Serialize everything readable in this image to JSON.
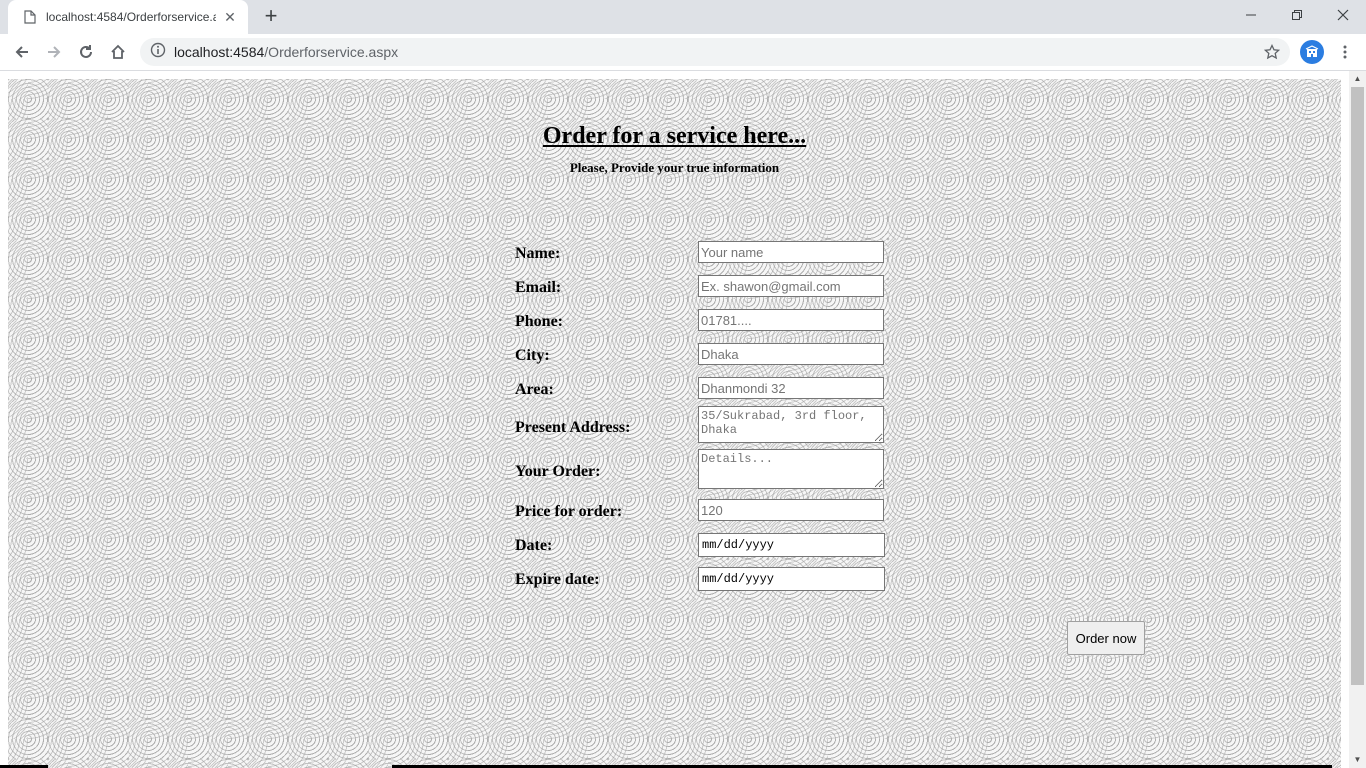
{
  "browser": {
    "tab_title": "localhost:4584/Orderforservice.as",
    "url_host": "localhost:4584",
    "url_path": "/Orderforservice.aspx"
  },
  "page": {
    "title": "Order for a service here...",
    "subtitle": "Please, Provide your true information",
    "form": {
      "name_label": "Name:",
      "name_placeholder": "Your name",
      "email_label": "Email:",
      "email_placeholder": "Ex. shawon@gmail.com",
      "phone_label": "Phone:",
      "phone_placeholder": "01781....",
      "city_label": "City:",
      "city_placeholder": "Dhaka",
      "area_label": "Area:",
      "area_placeholder": "Dhanmondi 32",
      "address_label": "Present Address:",
      "address_placeholder": "35/Sukrabad, 3rd floor, Dhaka",
      "order_label": "Your Order:",
      "order_placeholder": "Details...",
      "price_label": "Price for order:",
      "price_placeholder": "120",
      "date_label": "Date:",
      "date_value": "mm/dd/yyyy",
      "expire_label": "Expire date:",
      "expire_value": "mm/dd/yyyy"
    },
    "submit_label": "Order now"
  }
}
